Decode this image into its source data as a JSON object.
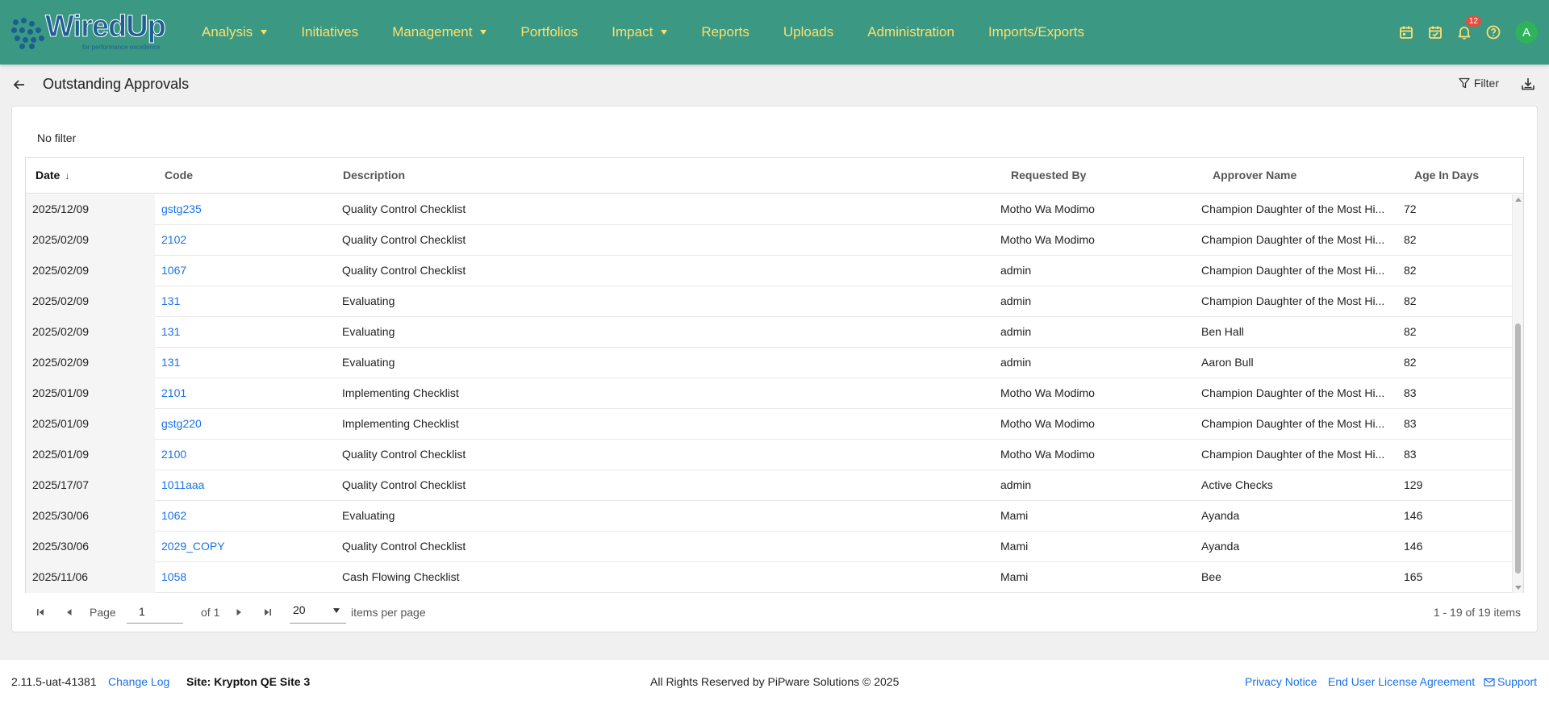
{
  "app": {
    "logo_text": "WiredUp",
    "logo_tagline": "for performance excellence"
  },
  "nav": {
    "items": [
      {
        "label": "Analysis",
        "has_caret": true
      },
      {
        "label": "Initiatives",
        "has_caret": false
      },
      {
        "label": "Management",
        "has_caret": true
      },
      {
        "label": "Portfolios",
        "has_caret": false
      },
      {
        "label": "Impact",
        "has_caret": true
      },
      {
        "label": "Reports",
        "has_caret": false
      },
      {
        "label": "Uploads",
        "has_caret": false
      },
      {
        "label": "Administration",
        "has_caret": false
      },
      {
        "label": "Imports/Exports",
        "has_caret": false
      }
    ],
    "notification_count": "12",
    "avatar_initial": "A",
    "icons": [
      "calendar-icon",
      "calendar-check-icon",
      "bell-icon",
      "help-icon"
    ]
  },
  "colors": {
    "topbar": "#3a9883",
    "nav_text": "#fde070",
    "link": "#1a73e8",
    "avatar": "#2eb35c",
    "badge": "#e74c3c"
  },
  "page": {
    "title": "Outstanding Approvals",
    "filter_label": "Filter",
    "filter_status": "No filter"
  },
  "table": {
    "columns": {
      "date": "Date",
      "code": "Code",
      "description": "Description",
      "requested_by": "Requested By",
      "approver_name": "Approver Name",
      "age_in_days": "Age In Days"
    },
    "sort": {
      "column": "Date",
      "direction": "descending"
    },
    "rows": [
      {
        "date": "2025/12/09",
        "code": "gstg235",
        "description": "Quality Control Checklist",
        "requested_by": "Motho Wa Modimo",
        "approver": "Champion Daughter of the Most Hi...",
        "age": "72"
      },
      {
        "date": "2025/02/09",
        "code": "2102",
        "description": "Quality Control Checklist",
        "requested_by": "Motho Wa Modimo",
        "approver": "Champion Daughter of the Most Hi...",
        "age": "82"
      },
      {
        "date": "2025/02/09",
        "code": "1067",
        "description": "Quality Control Checklist",
        "requested_by": "admin",
        "approver": "Champion Daughter of the Most Hi...",
        "age": "82"
      },
      {
        "date": "2025/02/09",
        "code": "131",
        "description": "Evaluating",
        "requested_by": "admin",
        "approver": "Champion Daughter of the Most Hi...",
        "age": "82"
      },
      {
        "date": "2025/02/09",
        "code": "131",
        "description": "Evaluating",
        "requested_by": "admin",
        "approver": "Ben Hall",
        "age": "82"
      },
      {
        "date": "2025/02/09",
        "code": "131",
        "description": "Evaluating",
        "requested_by": "admin",
        "approver": "Aaron Bull",
        "age": "82"
      },
      {
        "date": "2025/01/09",
        "code": "2101",
        "description": "Implementing Checklist",
        "requested_by": "Motho Wa Modimo",
        "approver": "Champion Daughter of the Most Hi...",
        "age": "83"
      },
      {
        "date": "2025/01/09",
        "code": "gstg220",
        "description": "Implementing Checklist",
        "requested_by": "Motho Wa Modimo",
        "approver": "Champion Daughter of the Most Hi...",
        "age": "83"
      },
      {
        "date": "2025/01/09",
        "code": "2100",
        "description": "Quality Control Checklist",
        "requested_by": "Motho Wa Modimo",
        "approver": "Champion Daughter of the Most Hi...",
        "age": "83"
      },
      {
        "date": "2025/17/07",
        "code": "1011aaa",
        "description": "Quality Control Checklist",
        "requested_by": "admin",
        "approver": "Active Checks",
        "age": "129"
      },
      {
        "date": "2025/30/06",
        "code": "1062",
        "description": "Evaluating",
        "requested_by": "Mami",
        "approver": "Ayanda",
        "age": "146"
      },
      {
        "date": "2025/30/06",
        "code": "2029_COPY",
        "description": "Quality Control Checklist",
        "requested_by": "Mami",
        "approver": "Ayanda",
        "age": "146"
      },
      {
        "date": "2025/11/06",
        "code": "1058",
        "description": "Cash Flowing Checklist",
        "requested_by": "Mami",
        "approver": "Bee",
        "age": "165"
      }
    ]
  },
  "pager": {
    "page_label": "Page",
    "page_value": "1",
    "of_label": "of 1",
    "page_size": "20",
    "per_page_label": "items per page",
    "summary": "1 - 19 of 19 items"
  },
  "footer": {
    "version": "2.11.5-uat-41381",
    "change_log": "Change Log",
    "site": "Site: Krypton QE Site 3",
    "rights": "All Rights Reserved by PiPware Solutions © 2025",
    "privacy": "Privacy Notice",
    "eula": "End User License Agreement",
    "support": "Support"
  }
}
